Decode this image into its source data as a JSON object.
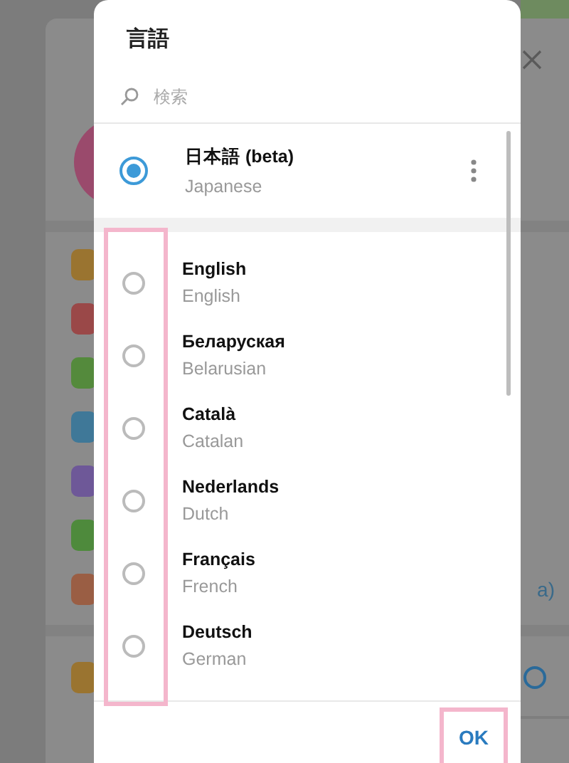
{
  "background_window": {
    "link_fragment": "a)",
    "radio": {
      "selected": false
    }
  },
  "dialog": {
    "title": "言語",
    "search": {
      "placeholder": "検索"
    },
    "current": {
      "name": "日本語 (beta)",
      "subtitle": "Japanese",
      "selected": true
    },
    "languages": [
      {
        "name": "English",
        "subtitle": "English",
        "selected": false
      },
      {
        "name": "Беларуская",
        "subtitle": "Belarusian",
        "selected": false
      },
      {
        "name": "Català",
        "subtitle": "Catalan",
        "selected": false
      },
      {
        "name": "Nederlands",
        "subtitle": "Dutch",
        "selected": false
      },
      {
        "name": "Français",
        "subtitle": "French",
        "selected": false
      },
      {
        "name": "Deutsch",
        "subtitle": "German",
        "selected": false
      }
    ],
    "ok_button": "OK"
  }
}
